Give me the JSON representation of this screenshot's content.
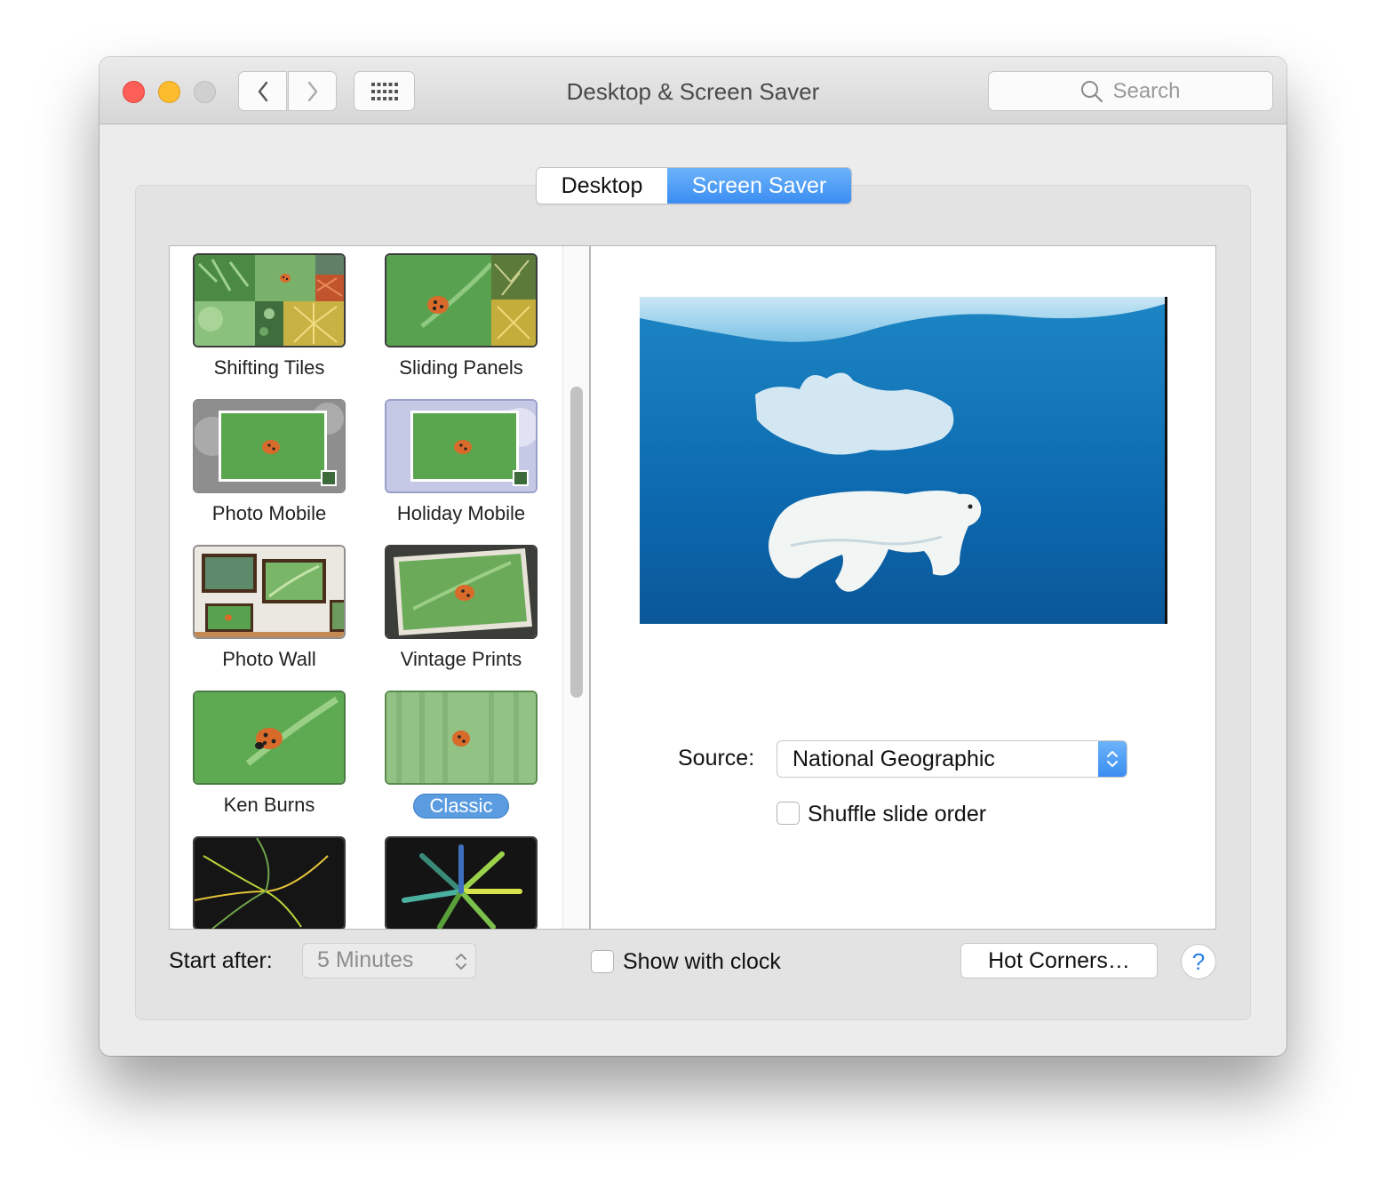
{
  "window": {
    "title": "Desktop & Screen Saver"
  },
  "toolbar": {
    "back_icon": "chevron-left-icon",
    "forward_icon": "chevron-right-icon",
    "grid_icon": "grid-icon",
    "search_placeholder": "Search"
  },
  "tabs": [
    {
      "label": "Desktop",
      "selected": false
    },
    {
      "label": "Screen Saver",
      "selected": true
    }
  ],
  "screensavers": [
    {
      "label": "Shifting Tiles"
    },
    {
      "label": "Sliding Panels"
    },
    {
      "label": "Photo Mobile"
    },
    {
      "label": "Holiday Mobile"
    },
    {
      "label": "Photo Wall"
    },
    {
      "label": "Vintage Prints"
    },
    {
      "label": "Ken Burns"
    },
    {
      "label": "Classic",
      "selected": true
    },
    {
      "label": ""
    },
    {
      "label": ""
    }
  ],
  "preview": {
    "source_label": "Source:",
    "source_value": "National Geographic",
    "shuffle_label": "Shuffle slide order",
    "shuffle_checked": false
  },
  "bottom": {
    "start_after_label": "Start after:",
    "start_after_value": "5 Minutes",
    "show_clock_label": "Show with clock",
    "show_clock_checked": false,
    "hot_corners_label": "Hot Corners…",
    "help_label": "?"
  },
  "colors": {
    "accent": "#3a8df2",
    "close": "#fc5f57",
    "minimize": "#fdbc2e",
    "zoom": "#d0d0d0"
  }
}
